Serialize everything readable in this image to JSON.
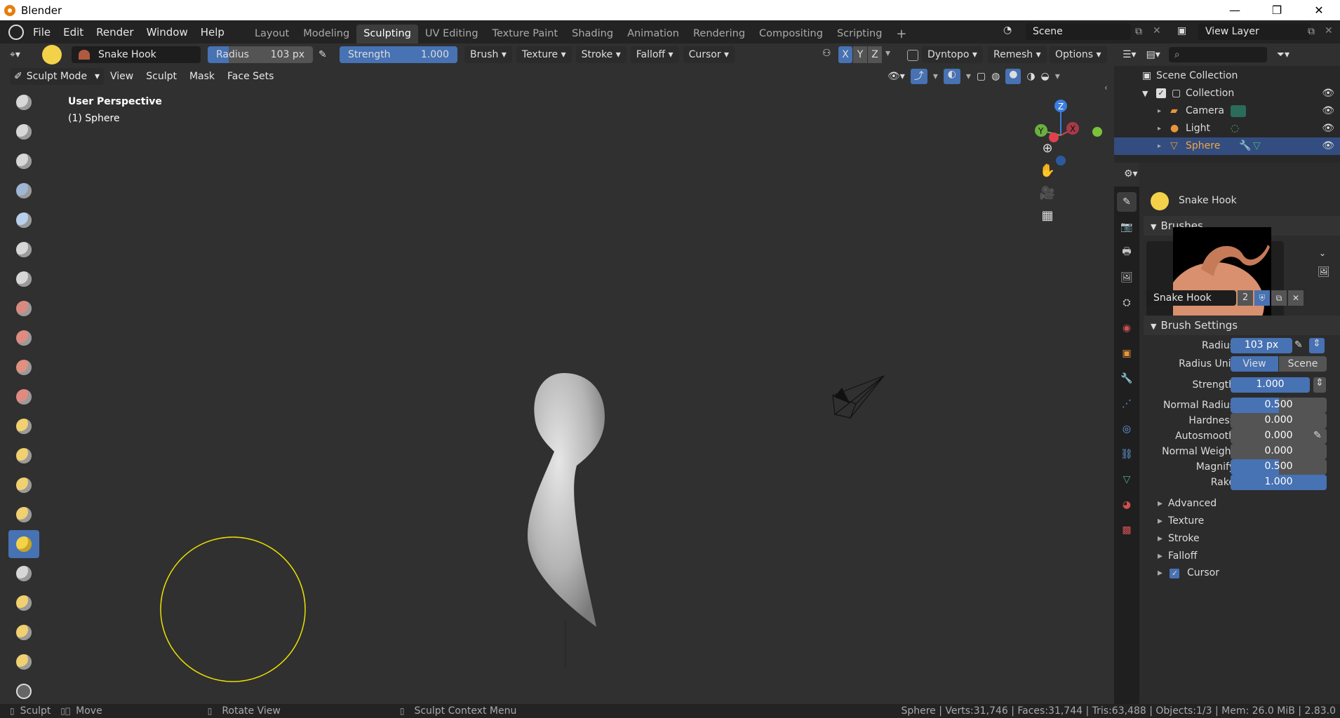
{
  "window": {
    "title": "Blender",
    "controls": [
      "—",
      "❐",
      "✕"
    ]
  },
  "menu": [
    "File",
    "Edit",
    "Render",
    "Window",
    "Help"
  ],
  "workspaces": [
    "Layout",
    "Modeling",
    "Sculpting",
    "UV Editing",
    "Texture Paint",
    "Shading",
    "Animation",
    "Rendering",
    "Compositing",
    "Scripting"
  ],
  "workspace_add": "+",
  "scene": {
    "name": "Scene"
  },
  "view_layer": {
    "name": "View Layer"
  },
  "tool_header": {
    "brush_name": "Snake Hook",
    "radius": {
      "label": "Radius",
      "value": "103 px",
      "fill": 0.2
    },
    "strength": {
      "label": "Strength",
      "value": "1.000",
      "fill": 1.0
    },
    "dropdowns": [
      "Brush",
      "Texture",
      "Stroke",
      "Falloff",
      "Cursor"
    ],
    "axes": [
      "X",
      "Y",
      "Z"
    ],
    "dyntopo": "Dyntopo",
    "remesh": "Remesh",
    "options": "Options"
  },
  "mode_header": {
    "mode": "Sculpt Mode",
    "menus": [
      "View",
      "Sculpt",
      "Mask",
      "Face Sets"
    ]
  },
  "viewport": {
    "perspective": "User Perspective",
    "object": "(1) Sphere",
    "gizmo": {
      "z": "Z",
      "y": "Y",
      "x": "X"
    }
  },
  "outliner": {
    "root": "Scene Collection",
    "collection": "Collection",
    "items": [
      "Camera",
      "Light",
      "Sphere"
    ],
    "selected": "Sphere"
  },
  "properties": {
    "brush_title": "Snake Hook",
    "brushes_panel": "Brushes",
    "brush_name": "Snake Hook",
    "brush_users": "2",
    "brush_settings_panel": "Brush Settings",
    "radius": {
      "label": "Radius",
      "value": "103 px"
    },
    "radius_unit": {
      "label": "Radius Unit",
      "options": [
        "View",
        "Scene"
      ],
      "selected": "View"
    },
    "rows": [
      {
        "label": "Strength",
        "value": "1.000",
        "fill": 1.0
      },
      {
        "label": "Normal Radius",
        "value": "0.500",
        "fill": 0.5
      },
      {
        "label": "Hardness",
        "value": "0.000",
        "fill": 0
      },
      {
        "label": "Autosmooth",
        "value": "0.000",
        "fill": 0
      },
      {
        "label": "Normal Weight",
        "value": "0.000",
        "fill": 0
      },
      {
        "label": "Magnify",
        "value": "0.500",
        "fill": 0.5
      },
      {
        "label": "Rake",
        "value": "1.000",
        "fill": 1.0
      }
    ],
    "subpanels": [
      "Advanced",
      "Texture",
      "Stroke",
      "Falloff",
      "Cursor"
    ]
  },
  "status": {
    "left": [
      "Sculpt",
      "Move",
      "Rotate View",
      "Sculpt Context Menu"
    ],
    "right": "Sphere | Verts:31,746 | Faces:31,744 | Tris:63,488 | Objects:1/3 | Mem: 26.0 MiB | 2.83.0"
  }
}
